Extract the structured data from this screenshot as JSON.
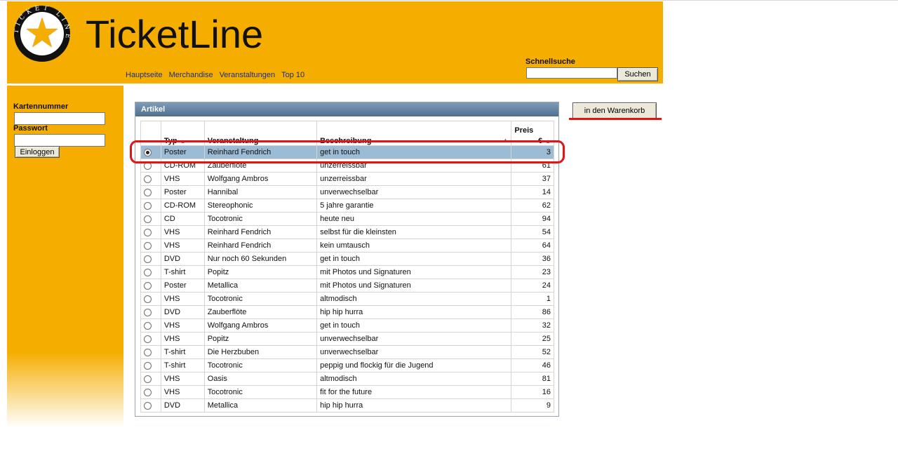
{
  "header": {
    "title": "TicketLine",
    "logo_ring_text": "TICKET LINE",
    "nav": [
      "Hauptseite",
      "Merchandise",
      "Veranstaltungen",
      "Top 10"
    ],
    "quick_search_label": "Schnellsuche",
    "quick_search_value": "",
    "search_button": "Suchen"
  },
  "sidebar": {
    "card_label": "Kartennummer",
    "password_label": "Passwort",
    "login_button": "Einloggen"
  },
  "panel": {
    "title": "Artikel",
    "columns": [
      "Typ",
      "Veranstaltung",
      "Beschreibung",
      "Preis",
      "€"
    ],
    "rows": [
      {
        "typ": "Poster",
        "veranstaltung": "Reinhard Fendrich",
        "beschreibung": "get in touch",
        "preis": "3",
        "selected": true
      },
      {
        "typ": "CD-ROM",
        "veranstaltung": "Zauberflöte",
        "beschreibung": "unzerreissbar",
        "preis": "61",
        "selected": false
      },
      {
        "typ": "VHS",
        "veranstaltung": "Wolfgang Ambros",
        "beschreibung": "unzerreissbar",
        "preis": "37",
        "selected": false
      },
      {
        "typ": "Poster",
        "veranstaltung": "Hannibal",
        "beschreibung": "unverwechselbar",
        "preis": "14",
        "selected": false
      },
      {
        "typ": "CD-ROM",
        "veranstaltung": "Stereophonic",
        "beschreibung": "5 jahre garantie",
        "preis": "62",
        "selected": false
      },
      {
        "typ": "CD",
        "veranstaltung": "Tocotronic",
        "beschreibung": "heute neu",
        "preis": "94",
        "selected": false
      },
      {
        "typ": "VHS",
        "veranstaltung": "Reinhard Fendrich",
        "beschreibung": "selbst für die kleinsten",
        "preis": "54",
        "selected": false
      },
      {
        "typ": "VHS",
        "veranstaltung": "Reinhard Fendrich",
        "beschreibung": "kein umtausch",
        "preis": "64",
        "selected": false
      },
      {
        "typ": "DVD",
        "veranstaltung": "Nur noch 60 Sekunden",
        "beschreibung": "get in touch",
        "preis": "36",
        "selected": false
      },
      {
        "typ": "T-shirt",
        "veranstaltung": "Popitz",
        "beschreibung": "mit Photos und Signaturen",
        "preis": "23",
        "selected": false
      },
      {
        "typ": "Poster",
        "veranstaltung": "Metallica",
        "beschreibung": "mit Photos und Signaturen",
        "preis": "24",
        "selected": false
      },
      {
        "typ": "VHS",
        "veranstaltung": "Tocotronic",
        "beschreibung": "altmodisch",
        "preis": "1",
        "selected": false
      },
      {
        "typ": "DVD",
        "veranstaltung": "Zauberflöte",
        "beschreibung": "hip hip hurra",
        "preis": "86",
        "selected": false
      },
      {
        "typ": "VHS",
        "veranstaltung": "Wolfgang Ambros",
        "beschreibung": "get in touch",
        "preis": "32",
        "selected": false
      },
      {
        "typ": "VHS",
        "veranstaltung": "Popitz",
        "beschreibung": "unverwechselbar",
        "preis": "25",
        "selected": false
      },
      {
        "typ": "T-shirt",
        "veranstaltung": "Die Herzbuben",
        "beschreibung": "unverwechselbar",
        "preis": "52",
        "selected": false
      },
      {
        "typ": "T-shirt",
        "veranstaltung": "Tocotronic",
        "beschreibung": "peppig und flockig für die Jugend",
        "preis": "46",
        "selected": false
      },
      {
        "typ": "VHS",
        "veranstaltung": "Oasis",
        "beschreibung": "altmodisch",
        "preis": "81",
        "selected": false
      },
      {
        "typ": "VHS",
        "veranstaltung": "Tocotronic",
        "beschreibung": "fit for the future",
        "preis": "16",
        "selected": false
      },
      {
        "typ": "DVD",
        "veranstaltung": "Metallica",
        "beschreibung": "hip hip hurra",
        "preis": "9",
        "selected": false
      }
    ]
  },
  "cart_button": "in den Warenkorb",
  "colors": {
    "brand_orange": "#f5ae00",
    "nav_link": "#1a2f80",
    "selected_row": "#9cbbd4",
    "annotation_red": "#e01616"
  }
}
